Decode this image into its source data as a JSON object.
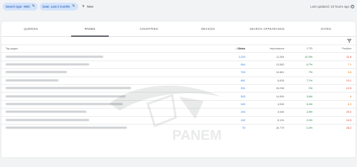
{
  "filters": {
    "search_type": "Search type: Web",
    "date": "Date: Last 3 months",
    "new_label": "New"
  },
  "status": {
    "last_updated": "Last updated: 10 hours ago"
  },
  "tabs": [
    {
      "label": "QUERIES"
    },
    {
      "label": "PAGES"
    },
    {
      "label": "COUNTRIES"
    },
    {
      "label": "DEVICES"
    },
    {
      "label": "SEARCH APPEARANCE"
    },
    {
      "label": "DATES"
    }
  ],
  "active_tab": "PAGES",
  "table": {
    "columns": {
      "page": "Top pages",
      "clicks": "Clicks",
      "impressions": "Impressions",
      "ctr": "CTR",
      "position": "Position"
    },
    "sort_arrow": "↓",
    "rows": [
      {
        "clicks": "1,215",
        "impressions": "11,284",
        "ctr": "10.3%",
        "position": "11.6"
      },
      {
        "clicks": "944",
        "impressions": "13,583",
        "ctr": "6.7%",
        "position": "7.1"
      },
      {
        "clicks": "753",
        "impressions": "10,861",
        "ctr": "7%",
        "position": "9.6"
      },
      {
        "clicks": "481",
        "impressions": "6,634",
        "ctr": "7.1%",
        "position": "10.1"
      },
      {
        "clicks": "331",
        "impressions": "26,238",
        "ctr": "2%",
        "position": "12.5"
      },
      {
        "clicks": "303",
        "impressions": "14,999",
        "ctr": "3.6%",
        "position": "6"
      },
      {
        "clicks": "245",
        "impressions": "4,536",
        "ctr": "5.4%",
        "position": "6.3"
      },
      {
        "clicks": "194",
        "impressions": "3,446",
        "ctr": "2.6%",
        "position": "20.2"
      },
      {
        "clicks": "132",
        "impressions": "8,124",
        "ctr": "2.4%",
        "position": "10.3"
      },
      {
        "clicks": "75",
        "impressions": "40,779",
        "ctr": "0.2%",
        "position": "26.2"
      }
    ]
  },
  "watermark_text": "PANEM",
  "colors": {
    "clicks": "#1a73e8",
    "ctr": "#188038",
    "position": "#e37400",
    "position_bad": "#d93025",
    "chip_bg": "#d2e3fc"
  }
}
